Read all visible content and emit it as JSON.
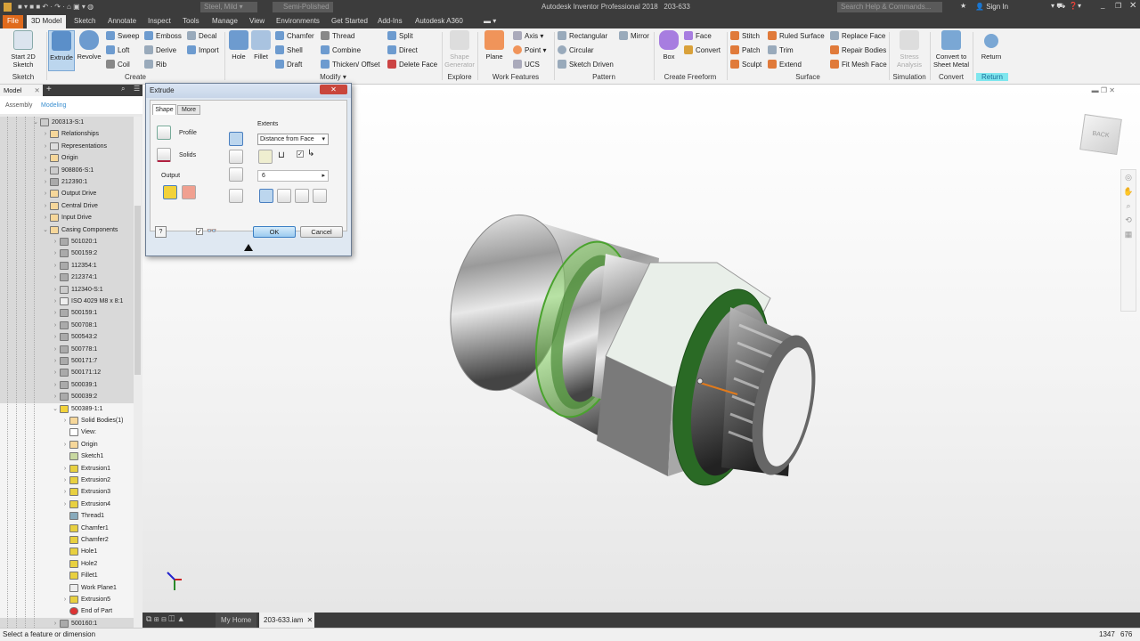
{
  "app": {
    "title": "Autodesk Inventor Professional 2018",
    "document": "203-633",
    "material": "Steel, Mild",
    "appearance": "Semi-Polished",
    "search_placeholder": "Search Help & Commands...",
    "sign_in": "Sign In"
  },
  "ribbon_tabs": [
    "File",
    "3D Model",
    "Sketch",
    "Annotate",
    "Inspect",
    "Tools",
    "Manage",
    "View",
    "Environments",
    "Get Started",
    "Add-Ins",
    "Autodesk A360"
  ],
  "ribbon": {
    "sketch": {
      "label": "Sketch",
      "start": "Start 2D Sketch"
    },
    "create": {
      "label": "Create",
      "extrude": "Extrude",
      "revolve": "Revolve",
      "sweep": "Sweep",
      "loft": "Loft",
      "coil": "Coil",
      "emboss": "Emboss",
      "derive": "Derive",
      "rib": "Rib",
      "decal": "Decal",
      "import": "Import"
    },
    "modify": {
      "label": "Modify ▾",
      "hole": "Hole",
      "fillet": "Fillet",
      "chamfer": "Chamfer",
      "shell": "Shell",
      "draft": "Draft",
      "thread": "Thread",
      "combine": "Combine",
      "thicken": "Thicken/ Offset",
      "split": "Split",
      "direct": "Direct",
      "delete_face": "Delete Face"
    },
    "explore": {
      "label": "Explore",
      "shape_generator": "Shape Generator"
    },
    "work_features": {
      "label": "Work Features",
      "plane": "Plane",
      "axis": "Axis ▾",
      "point": "Point ▾",
      "ucs": "UCS"
    },
    "pattern": {
      "label": "Pattern",
      "rectangular": "Rectangular",
      "circular": "Circular",
      "sketch_driven": "Sketch Driven",
      "mirror": "Mirror"
    },
    "freeform": {
      "label": "Create Freeform",
      "box": "Box",
      "face": "Face",
      "convert": "Convert"
    },
    "surface": {
      "label": "Surface",
      "stitch": "Stitch",
      "patch": "Patch",
      "sculpt": "Sculpt",
      "ruled": "Ruled Surface",
      "trim": "Trim",
      "extend": "Extend",
      "replace": "Replace Face",
      "repair": "Repair Bodies",
      "fit_mesh": "Fit Mesh Face"
    },
    "simulation": {
      "label": "Simulation",
      "stress": "Stress Analysis"
    },
    "convert": {
      "label": "Convert",
      "sheet_metal": "Convert to Sheet Metal"
    },
    "return": {
      "label": "Return",
      "return": "Return"
    }
  },
  "browser": {
    "tab": "Model",
    "tabs": [
      "Assembly",
      "Modeling"
    ],
    "tree": [
      {
        "d": 0,
        "t": "200313-S:1",
        "i": "asm",
        "e": "v",
        "g": 1
      },
      {
        "d": 1,
        "t": "Relationships",
        "i": "folder",
        "e": ">",
        "g": 1
      },
      {
        "d": 1,
        "t": "Representations",
        "i": "rep",
        "e": ">",
        "g": 1
      },
      {
        "d": 1,
        "t": "Origin",
        "i": "folder",
        "e": ">",
        "g": 1
      },
      {
        "d": 1,
        "t": "908806-S:1",
        "i": "asm",
        "e": ">",
        "g": 1
      },
      {
        "d": 1,
        "t": "212390:1",
        "i": "part",
        "e": ">",
        "g": 1
      },
      {
        "d": 1,
        "t": "Output Drive",
        "i": "folder",
        "e": ">",
        "g": 1
      },
      {
        "d": 1,
        "t": "Central Drive",
        "i": "folder",
        "e": ">",
        "g": 1
      },
      {
        "d": 1,
        "t": "Input Drive",
        "i": "folder",
        "e": ">",
        "g": 1
      },
      {
        "d": 1,
        "t": "Casing Components",
        "i": "folder",
        "e": "v",
        "g": 1
      },
      {
        "d": 2,
        "t": "501020:1",
        "i": "part",
        "e": ">",
        "g": 1
      },
      {
        "d": 2,
        "t": "500159:2",
        "i": "part",
        "e": ">",
        "g": 1
      },
      {
        "d": 2,
        "t": "112354:1",
        "i": "part",
        "e": ">",
        "g": 1
      },
      {
        "d": 2,
        "t": "212374:1",
        "i": "part",
        "e": ">",
        "g": 1
      },
      {
        "d": 2,
        "t": "112340-S:1",
        "i": "asm",
        "e": ">",
        "g": 1
      },
      {
        "d": 2,
        "t": "ISO 4029 M8 x 8:1",
        "i": "bolt",
        "e": ">",
        "g": 1
      },
      {
        "d": 2,
        "t": "500159:1",
        "i": "part",
        "e": ">",
        "g": 1
      },
      {
        "d": 2,
        "t": "500708:1",
        "i": "part",
        "e": ">",
        "g": 1
      },
      {
        "d": 2,
        "t": "500543:2",
        "i": "part",
        "e": ">",
        "g": 1
      },
      {
        "d": 2,
        "t": "500778:1",
        "i": "part",
        "e": ">",
        "g": 1
      },
      {
        "d": 2,
        "t": "500171:7",
        "i": "part",
        "e": ">",
        "g": 1
      },
      {
        "d": 2,
        "t": "500171:12",
        "i": "part",
        "e": ">",
        "g": 1
      },
      {
        "d": 2,
        "t": "500039:1",
        "i": "part",
        "e": ">",
        "g": 1
      },
      {
        "d": 2,
        "t": "500039:2",
        "i": "part",
        "e": ">",
        "g": 1
      },
      {
        "d": 2,
        "t": "500389-1:1",
        "i": "active",
        "e": "v",
        "g": 0
      },
      {
        "d": 3,
        "t": "Solid Bodies(1)",
        "i": "folder",
        "e": ">",
        "g": 0
      },
      {
        "d": 3,
        "t": "View:",
        "i": "view",
        "e": "",
        "g": 0
      },
      {
        "d": 3,
        "t": "Origin",
        "i": "folder",
        "e": ">",
        "g": 0
      },
      {
        "d": 3,
        "t": "Sketch1",
        "i": "sketch",
        "e": "",
        "g": 0
      },
      {
        "d": 3,
        "t": "Extrusion1",
        "i": "feature",
        "e": ">",
        "g": 0
      },
      {
        "d": 3,
        "t": "Extrusion2",
        "i": "feature",
        "e": ">",
        "g": 0
      },
      {
        "d": 3,
        "t": "Extrusion3",
        "i": "feature",
        "e": ">",
        "g": 0
      },
      {
        "d": 3,
        "t": "Extrusion4",
        "i": "feature",
        "e": ">",
        "g": 0
      },
      {
        "d": 3,
        "t": "Thread1",
        "i": "thread",
        "e": "",
        "g": 0
      },
      {
        "d": 3,
        "t": "Chamfer1",
        "i": "feature",
        "e": "",
        "g": 0
      },
      {
        "d": 3,
        "t": "Chamfer2",
        "i": "feature",
        "e": "",
        "g": 0
      },
      {
        "d": 3,
        "t": "Hole1",
        "i": "feature",
        "e": "",
        "g": 0
      },
      {
        "d": 3,
        "t": "Hole2",
        "i": "feature",
        "e": "",
        "g": 0
      },
      {
        "d": 3,
        "t": "Fillet1",
        "i": "feature",
        "e": "",
        "g": 0
      },
      {
        "d": 3,
        "t": "Work Plane1",
        "i": "plane",
        "e": "",
        "g": 0
      },
      {
        "d": 3,
        "t": "Extrusion5",
        "i": "feature",
        "e": ">",
        "g": 0
      },
      {
        "d": 3,
        "t": "End of Part",
        "i": "end",
        "e": "",
        "g": 0
      },
      {
        "d": 2,
        "t": "500160:1",
        "i": "part",
        "e": ">",
        "g": 1
      }
    ]
  },
  "dialog": {
    "title": "Extrude",
    "tabs": [
      "Shape",
      "More"
    ],
    "profile": "Profile",
    "solids": "Solids",
    "output": "Output",
    "extents": "Extents",
    "extents_value": "Distance from Face",
    "distance": "6",
    "ok": "OK",
    "cancel": "Cancel"
  },
  "doc_tabs": {
    "home": "My Home",
    "active": "203-633.iam"
  },
  "status": {
    "message": "Select a feature or dimension",
    "x": "1347",
    "y": "676"
  },
  "viewcube": {
    "face": "BACK"
  },
  "colors": {
    "accent": "#e06a1c",
    "green": "#3f8f2f",
    "return": "#7fe6ee"
  }
}
